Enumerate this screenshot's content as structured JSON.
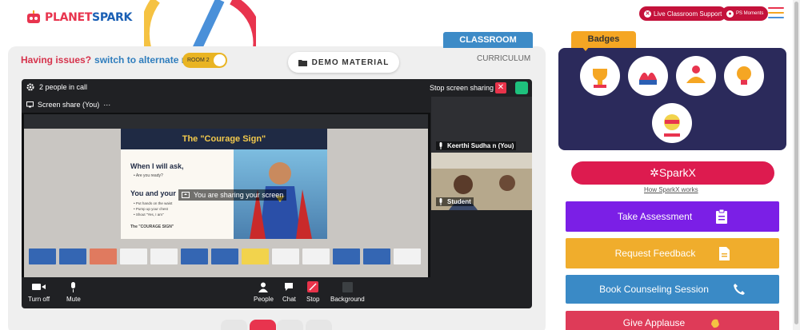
{
  "header": {
    "logo_text_1": "PLANET",
    "logo_text_2": "SPARK",
    "live_support_label": "Live Classroom Support",
    "ps_moments_label": "PS Moments"
  },
  "classroom": {
    "issues_text": "Having issues?",
    "switch_text": "switch to alternate room",
    "room_toggle_label": "ROOM 2",
    "demo_material_label": "DEMO MATERIAL",
    "tab_classroom": "CLASSROOM",
    "tab_curriculum": "CURRICULUM"
  },
  "meet": {
    "people_in_call": "2 people in call",
    "stop_sharing_label": "Stop screen sharing",
    "screen_share_label": "Screen share (You)",
    "sharing_msg": "You are sharing your screen",
    "participant_you": "Keerthi Sudha n (You)",
    "participant_student": "Student",
    "slide": {
      "title": "The \"Courage Sign\"",
      "h1": "When I will ask,",
      "b1": "• Are you ready?",
      "h2": "You and your",
      "b2_1": "• Put hands on the waist",
      "b2_2": "• Pump up your chest",
      "b2_3": "• Shout \"Yes, I am\"",
      "footer": "The \"COURAGE SIGN\""
    },
    "controls": {
      "turn_off": "Turn off",
      "mute": "Mute",
      "people": "People",
      "chat": "Chat",
      "stop": "Stop",
      "background": "Background"
    }
  },
  "sidebar": {
    "badges_title": "Badges",
    "sparkx_label": "SparkX",
    "how_sparkx": "How SparkX works",
    "actions": [
      {
        "label": "Take Assessment",
        "color": "#7b1fe6"
      },
      {
        "label": "Request Feedback",
        "color": "#f0ad2c"
      },
      {
        "label": "Book Counseling Session",
        "color": "#3a8ac6"
      },
      {
        "label": "Give Applause",
        "color": "#de3b58"
      }
    ]
  },
  "colors": {
    "brand_red": "#c4123b",
    "meet_bg": "#202124",
    "badge_bg": "#2b2a5b"
  }
}
